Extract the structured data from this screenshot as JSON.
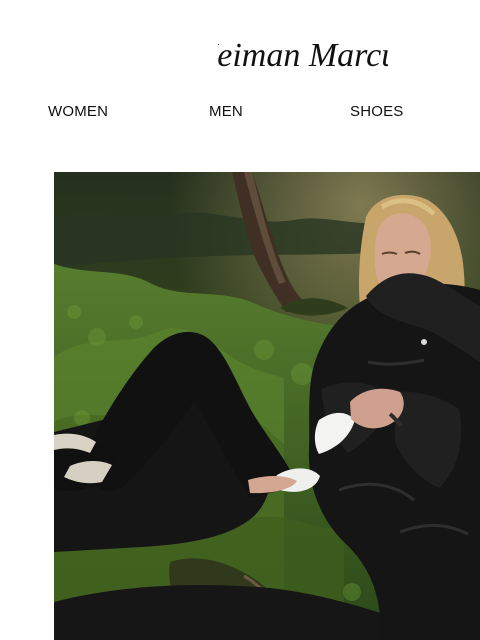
{
  "brand": {
    "name": "Neiman Marcus",
    "logo_icon": "neiman-marcus-script-logo"
  },
  "nav": {
    "items": [
      {
        "label": "WOMEN"
      },
      {
        "label": "MEN"
      },
      {
        "label": "SHOES"
      }
    ]
  },
  "hero": {
    "icon": "forest-model-photo",
    "colors": {
      "moss": "#3f6b25",
      "forest_dark": "#1d2615",
      "jacket": "#151515",
      "hair": "#c8a56a"
    }
  }
}
